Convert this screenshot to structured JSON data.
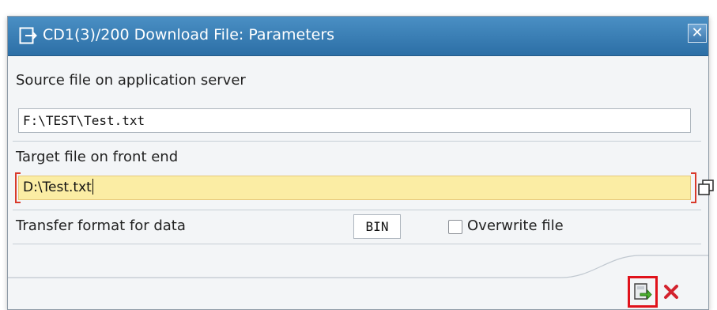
{
  "dialog": {
    "title": "CD1(3)/200 Download File: Parameters",
    "title_icon": "dialog-arrow-icon",
    "close_icon": "close-icon",
    "close_glyph": "✕"
  },
  "fields": {
    "source_label": "Source file on application server",
    "source_value": "F:\\TEST\\Test.txt",
    "target_label": "Target file on front end",
    "target_value": "D:\\Test.txt",
    "format_label": "Transfer format for data",
    "format_value": "BIN",
    "overwrite_label": "Overwrite file",
    "overwrite_checked": false
  },
  "footer": {
    "continue_icon": "continue-icon",
    "cancel_icon": "cancel-icon"
  },
  "colors": {
    "titlebar": "#2c6fa6",
    "required_field": "#fbeda4",
    "required_bracket": "#d93a2b",
    "highlight_box": "#e0121b",
    "cancel_red": "#d3232e"
  }
}
